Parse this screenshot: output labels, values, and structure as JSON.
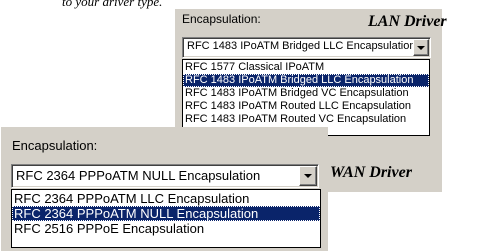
{
  "caption_top": "to your driver type.",
  "lan": {
    "label": "Encapsulation:",
    "selected_value": "RFC 1483 IPoATM Bridged LLC Encapsulation",
    "options": [
      {
        "label": "RFC 1577 Classical IPoATM",
        "selected": false
      },
      {
        "label": "RFC 1483 IPoATM Bridged LLC Encapsulation",
        "selected": true
      },
      {
        "label": "RFC 1483 IPoATM Bridged VC Encapsulation",
        "selected": false
      },
      {
        "label": "RFC 1483 IPoATM Routed LLC Encapsulation",
        "selected": false
      },
      {
        "label": "RFC 1483 IPoATM Routed VC Encapsulation",
        "selected": false
      }
    ],
    "driver_label": "LAN Driver"
  },
  "wan": {
    "label": "Encapsulation:",
    "selected_value": "RFC 2364 PPPoATM NULL Encapsulation",
    "options": [
      {
        "label": "RFC 2364 PPPoATM LLC Encapsulation",
        "selected": false
      },
      {
        "label": "RFC 2364 PPPoATM NULL Encapsulation",
        "selected": true
      },
      {
        "label": "RFC 2516 PPPoE Encapsulation",
        "selected": false
      }
    ],
    "driver_label": "WAN Driver"
  },
  "icons": {
    "dropdown_arrow": "chevron-down-icon"
  }
}
